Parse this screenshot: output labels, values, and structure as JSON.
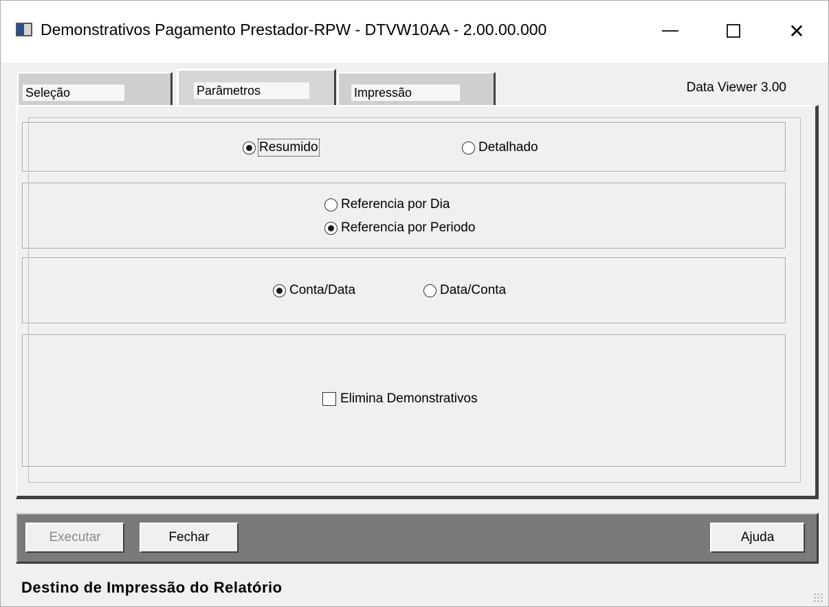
{
  "window": {
    "title": "Demonstrativos Pagamento Prestador-RPW - DTVW10AA - 2.00.00.000",
    "app_icon": "app-window-icon",
    "controls": [
      "minimize-icon",
      "maximize-icon",
      "close-icon"
    ],
    "close_glyph": "✕"
  },
  "tabs": [
    {
      "label": "Seleção",
      "active": false
    },
    {
      "label": "Parâmetros",
      "active": true
    },
    {
      "label": "Impressão",
      "active": false
    }
  ],
  "data_viewer_label": "Data Viewer 3.00",
  "groups": {
    "tipo": {
      "options": [
        {
          "label": "Resumido",
          "selected": true,
          "focused": true
        },
        {
          "label": "Detalhado",
          "selected": false
        }
      ]
    },
    "referencia": {
      "options": [
        {
          "label": "Referencia por Dia",
          "selected": false
        },
        {
          "label": "Referencia por Periodo",
          "selected": true
        }
      ]
    },
    "ordem": {
      "options": [
        {
          "label": "Conta/Data",
          "selected": true
        },
        {
          "label": "Data/Conta",
          "selected": false
        }
      ]
    },
    "elimina": {
      "checkbox_label": "Elimina Demonstrativos",
      "checked": false
    }
  },
  "buttons": {
    "executar": "Executar",
    "fechar": "Fechar",
    "ajuda": "Ajuda"
  },
  "status_text": "Destino de Impressão do Relatório",
  "colors": {
    "background": "#f0f0f0",
    "button_bar": "#7a7a7a",
    "disabled_text": "#8a8a8a"
  }
}
